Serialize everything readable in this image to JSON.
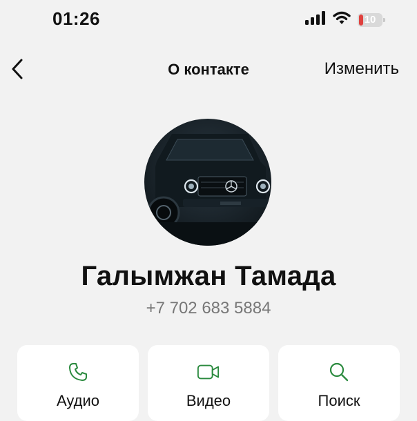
{
  "status_bar": {
    "time": "01:26",
    "battery_level": "10",
    "icons": [
      "signal-icon",
      "wifi-icon",
      "battery-icon"
    ]
  },
  "nav": {
    "back_icon": "chevron-left-icon",
    "title": "О контакте",
    "edit_label": "Изменить"
  },
  "contact": {
    "name": "Галымжан Тамада",
    "phone": "+7 702 683 5884",
    "avatar_image": "dark SUV front view"
  },
  "actions": [
    {
      "label": "Аудио",
      "icon": "phone-icon"
    },
    {
      "label": "Видео",
      "icon": "video-camera-icon"
    },
    {
      "label": "Поиск",
      "icon": "search-icon"
    }
  ],
  "colors": {
    "background": "#f2f2f2",
    "accent": "#2a8a3e",
    "battery_low": "#e0413e"
  }
}
